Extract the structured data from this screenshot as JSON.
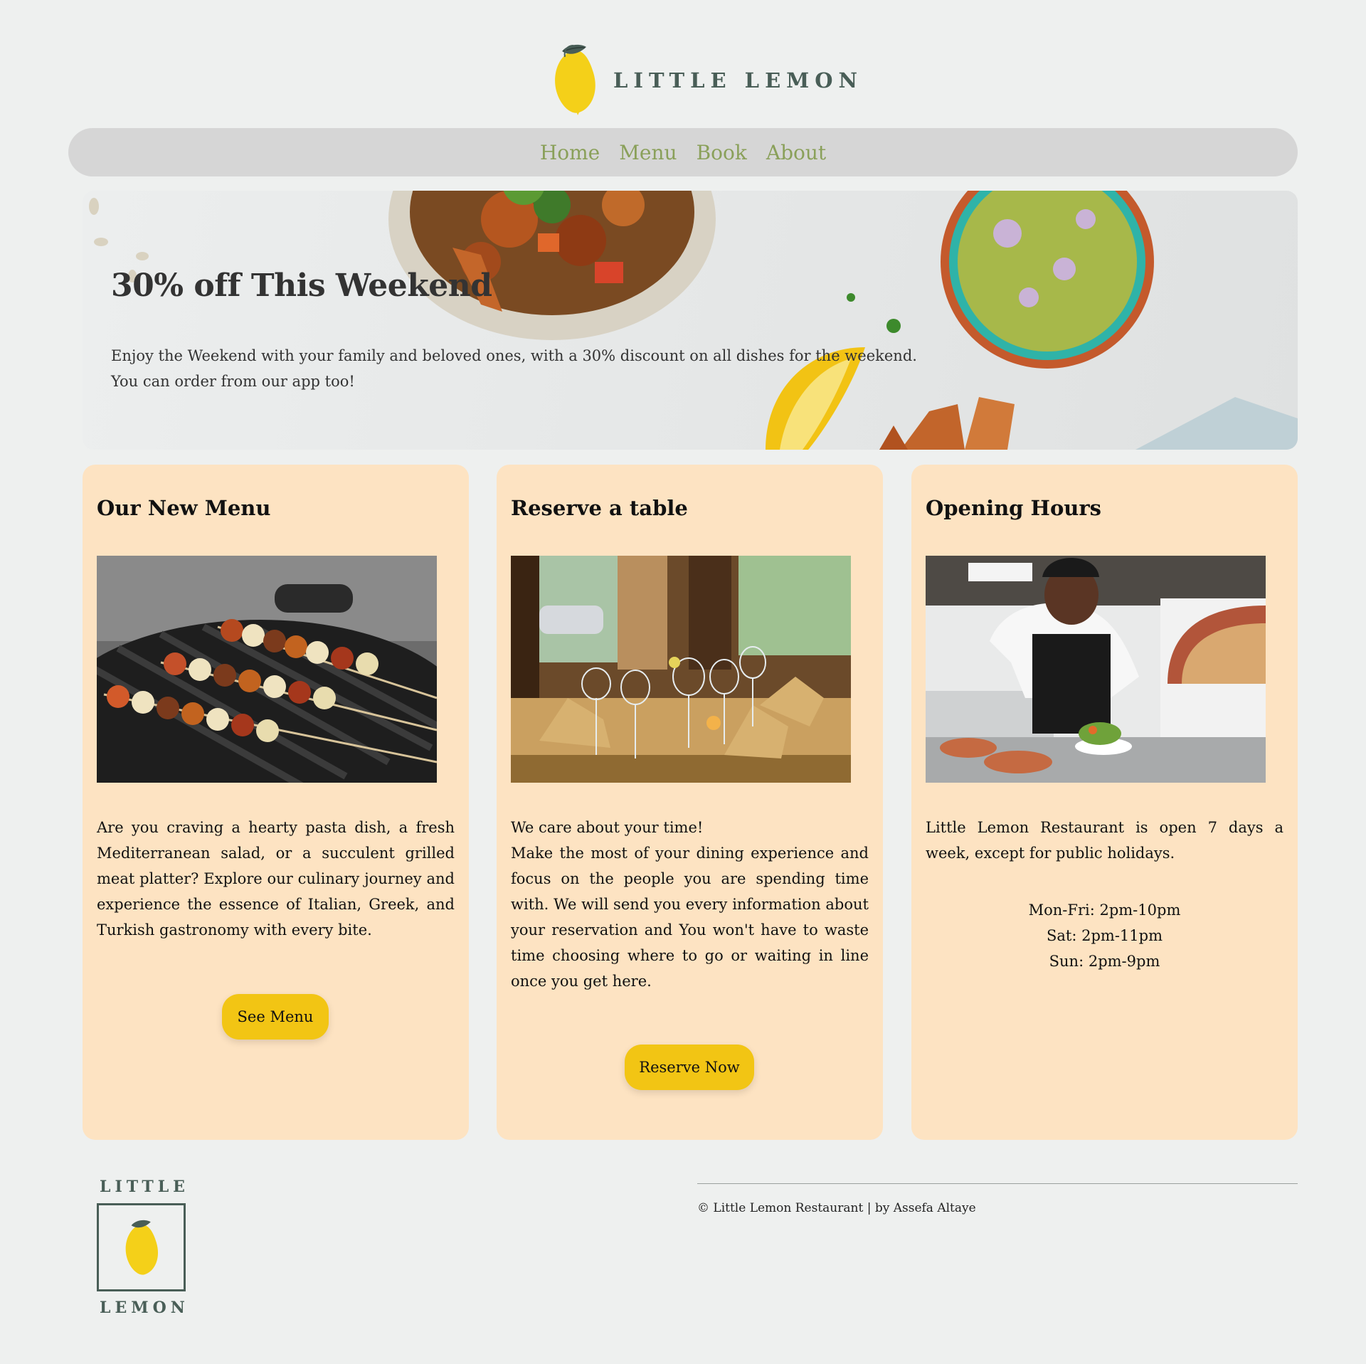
{
  "brand": {
    "name": "LITTLE LEMON",
    "footer_top": "LITTLE",
    "footer_bottom": "LEMON"
  },
  "nav": {
    "items": [
      "Home",
      "Menu",
      "Book",
      "About"
    ]
  },
  "hero": {
    "title": "30% off This Weekend",
    "line1": "Enjoy the Weekend with your family and beloved ones, with a 30% discount on all dishes for the weekend.",
    "line2": "You can order from our app too!"
  },
  "cards": {
    "menu": {
      "title": "Our New Menu",
      "text": "Are you craving a hearty pasta dish, a fresh Mediterranean salad, or a succulent grilled meat platter? Explore our culinary journey and experience the essence of Italian, Greek, and Turkish gastronomy with every bite.",
      "button": "See Menu"
    },
    "reserve": {
      "title": "Reserve a table",
      "line1": "We care about your time!",
      "text": "Make the most of your dining experience and focus on the people you are spending time with. We will send you every information about your reservation and You won't have to waste time choosing where to go or waiting in line once you get here.",
      "button": "Reserve Now"
    },
    "hours": {
      "title": "Opening Hours",
      "text": "Little Lemon Restaurant is open 7 days a week, except for public holidays.",
      "rows": [
        "Mon-Fri: 2pm-10pm",
        "Sat: 2pm-11pm",
        "Sun: 2pm-9pm"
      ]
    }
  },
  "footer": {
    "copyright": "© Little Lemon Restaurant | by Assefa Altaye"
  },
  "colors": {
    "accent": "#f2c514",
    "brand_green": "#495e57",
    "nav_link": "#8aa05a",
    "card_bg": "#fde3c2",
    "page_bg": "#eef0ef"
  },
  "icons": {
    "logo": "lemon-icon"
  }
}
